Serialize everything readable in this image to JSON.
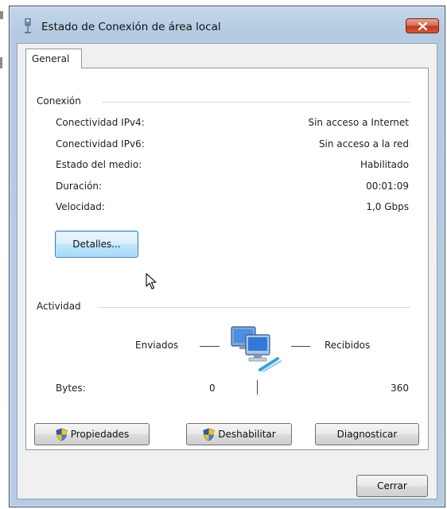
{
  "window": {
    "title": "Estado de Conexión de área local",
    "close_icon": "close-x-icon",
    "title_icon": "network-adapter-icon"
  },
  "tabs": [
    {
      "label": "General",
      "selected": true
    }
  ],
  "connection": {
    "group_label": "Conexión",
    "rows": [
      {
        "label": "Conectividad IPv4:",
        "value": "Sin acceso a Internet"
      },
      {
        "label": "Conectividad IPv6:",
        "value": "Sin acceso a la red"
      },
      {
        "label": "Estado del medio:",
        "value": "Habilitado"
      },
      {
        "label": "Duración:",
        "value": "00:01:09"
      },
      {
        "label": "Velocidad:",
        "value": "1,0 Gbps"
      }
    ],
    "details_button": "Detalles..."
  },
  "activity": {
    "group_label": "Actividad",
    "sent_label": "Enviados",
    "received_label": "Recibidos",
    "bytes_label": "Bytes:",
    "bytes_sent": "0",
    "bytes_received": "360",
    "icon": "network-computers-icon"
  },
  "buttons": {
    "properties": "Propiedades",
    "disable": "Deshabilitar",
    "diagnose": "Diagnosticar",
    "close": "Cerrar",
    "shield_icon": "uac-shield-icon"
  },
  "colors": {
    "title_bar": "#b5cbe2",
    "close_button": "#c0391c",
    "focused_button": "#bee6fd"
  }
}
